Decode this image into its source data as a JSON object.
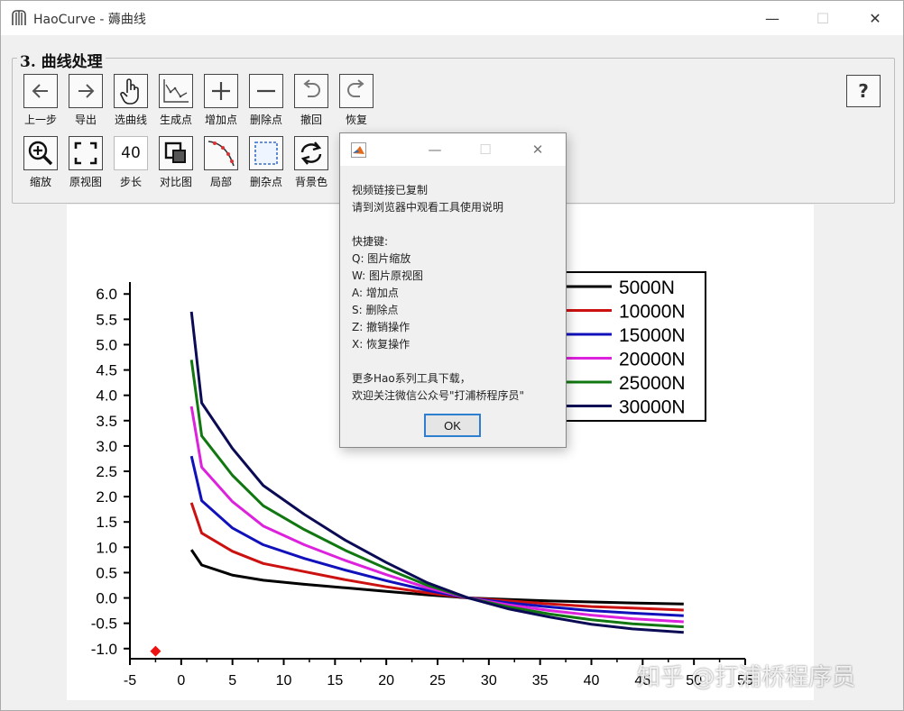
{
  "window": {
    "title": "HaoCurve - 薅曲线",
    "minimize": "—",
    "maximize": "☐",
    "close": "✕"
  },
  "group": {
    "title": "3. 曲线处理",
    "row1": [
      {
        "label": "上一步",
        "icon": "arrow-left-icon"
      },
      {
        "label": "导出",
        "icon": "arrow-right-icon"
      },
      {
        "label": "选曲线",
        "icon": "hand-pointer-icon"
      },
      {
        "label": "生成点",
        "icon": "chart-points-icon"
      },
      {
        "label": "增加点",
        "icon": "plus-icon"
      },
      {
        "label": "删除点",
        "icon": "minus-icon"
      },
      {
        "label": "撤回",
        "icon": "undo-icon"
      },
      {
        "label": "恢复",
        "icon": "redo-icon"
      }
    ],
    "row2": [
      {
        "label": "缩放",
        "icon": "zoom-in-icon"
      },
      {
        "label": "原视图",
        "icon": "fit-view-icon"
      },
      {
        "label": "步长",
        "icon": "step-input"
      },
      {
        "label": "对比图",
        "icon": "compare-icon"
      },
      {
        "label": "局部",
        "icon": "local-curve-icon"
      },
      {
        "label": "删杂点",
        "icon": "select-box-icon"
      },
      {
        "label": "背景色",
        "icon": "swap-icon"
      }
    ],
    "step_value": "40",
    "help": "?"
  },
  "dialog": {
    "title": "",
    "text": "视频链接已复制\n请到浏览器中观看工具使用说明\n\n快捷键:\nQ: 图片缩放\nW: 图片原视图\nA: 增加点\nS: 删除点\nZ: 撤销操作\nX: 恢复操作\n\n更多Hao系列工具下载，\n欢迎关注微信公众号\"打浦桥程序员\"",
    "ok": "OK"
  },
  "watermark": "知乎 @打浦桥程序员",
  "chart_data": {
    "type": "line",
    "x_ticks": [
      "-5",
      "0",
      "5",
      "10",
      "15",
      "20",
      "25",
      "30",
      "35",
      "40",
      "45",
      "50",
      "55"
    ],
    "y_ticks": [
      "6.0",
      "5.5",
      "5.0",
      "4.5",
      "4.0",
      "3.5",
      "3.0",
      "2.5",
      "2.0",
      "1.5",
      "1.0",
      "0.5",
      "0.0",
      "-0.5",
      "-1.0"
    ],
    "xlim": [
      -5,
      55
    ],
    "ylim": [
      -1.2,
      6.2
    ],
    "x": [
      1,
      2,
      5,
      8,
      12,
      16,
      20,
      24,
      28,
      32,
      36,
      40,
      44,
      49
    ],
    "series": [
      {
        "name": "5000N",
        "color": "#000000",
        "values": [
          0.95,
          0.65,
          0.45,
          0.35,
          0.27,
          0.2,
          0.13,
          0.06,
          0.0,
          -0.03,
          -0.06,
          -0.08,
          -0.1,
          -0.12
        ]
      },
      {
        "name": "10000N",
        "color": "#cc1111",
        "values": [
          1.88,
          1.28,
          0.92,
          0.68,
          0.52,
          0.36,
          0.22,
          0.1,
          0.0,
          -0.06,
          -0.12,
          -0.17,
          -0.2,
          -0.24
        ]
      },
      {
        "name": "15000N",
        "color": "#1111bb",
        "values": [
          2.8,
          1.92,
          1.38,
          1.05,
          0.78,
          0.55,
          0.34,
          0.15,
          0.0,
          -0.1,
          -0.18,
          -0.25,
          -0.3,
          -0.35
        ]
      },
      {
        "name": "20000N",
        "color": "#dd22dd",
        "values": [
          3.78,
          2.58,
          1.9,
          1.42,
          1.05,
          0.74,
          0.46,
          0.2,
          0.0,
          -0.14,
          -0.25,
          -0.34,
          -0.41,
          -0.47
        ]
      },
      {
        "name": "25000N",
        "color": "#117711",
        "values": [
          4.7,
          3.2,
          2.42,
          1.82,
          1.35,
          0.94,
          0.58,
          0.25,
          0.0,
          -0.18,
          -0.32,
          -0.43,
          -0.51,
          -0.57
        ]
      },
      {
        "name": "30000N",
        "color": "#0b0b55",
        "values": [
          5.65,
          3.85,
          2.95,
          2.22,
          1.65,
          1.14,
          0.7,
          0.3,
          0.0,
          -0.22,
          -0.38,
          -0.52,
          -0.61,
          -0.68
        ]
      }
    ],
    "marker": {
      "x": -2.5,
      "y": -1.05,
      "color": "#ee1111"
    },
    "legend_position": "top-right"
  }
}
